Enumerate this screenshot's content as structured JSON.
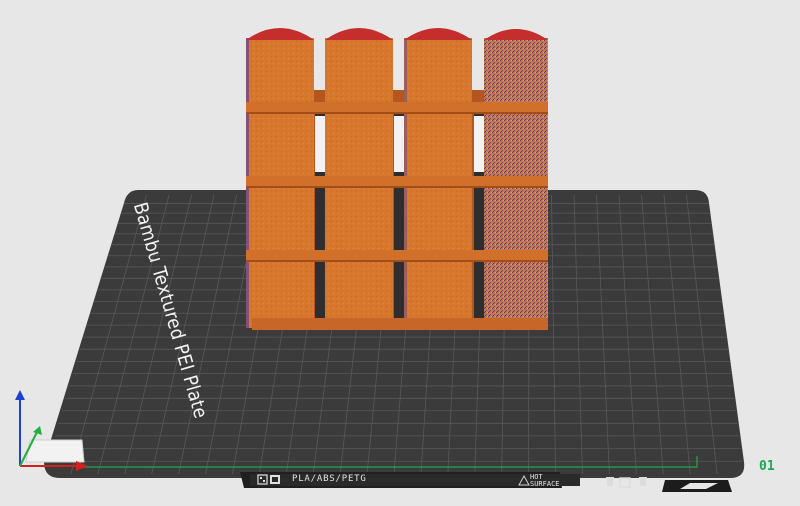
{
  "plate": {
    "name": "Bambu Textured PEI Plate",
    "index": "01",
    "filament_types": "PLA/ABS/PETG",
    "warning_line1": "HOT",
    "warning_line2": "SURFACE"
  },
  "colors": {
    "background": "#e7e7e8",
    "plate": "#3b3b3b",
    "grid": "#5a5a5a",
    "model_body": "#d9782e",
    "model_shadow": "#b85f22",
    "model_top": "#c42e2c",
    "seam_pattern": "#5a3aa0",
    "axis_x": "#d02020",
    "axis_y": "#20b040",
    "axis_z": "#1e3fd0",
    "plate_index": "#1ea84f"
  },
  "icons": {
    "axis_gizmo": "xyz-axis-icon",
    "plate_type": "plate-type-icon",
    "plate_options": "plate-options-icon"
  }
}
